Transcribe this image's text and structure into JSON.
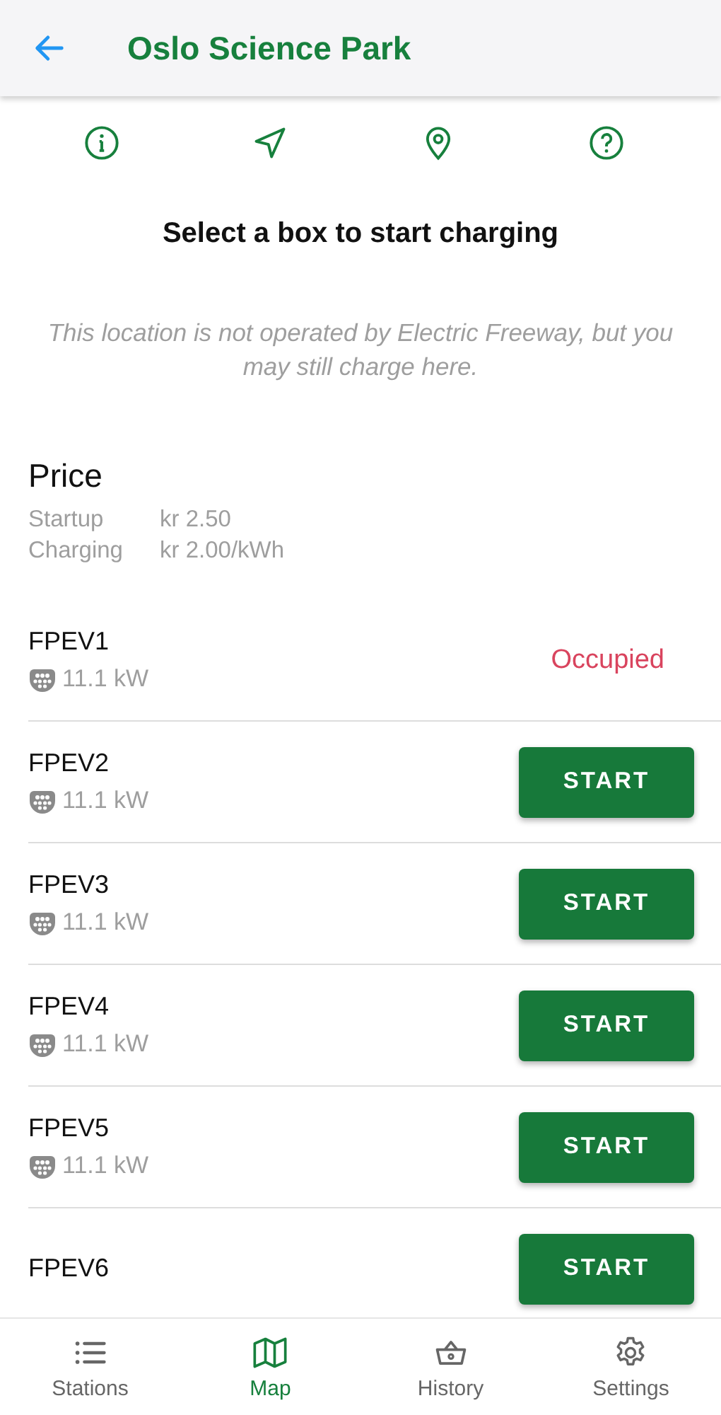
{
  "header": {
    "title": "Oslo Science Park"
  },
  "heading": "Select a box to start charging",
  "notice": "This location is not operated by Electric Freeway, but you may still charge here.",
  "price": {
    "title": "Price",
    "items": [
      {
        "label": "Startup",
        "value": "kr 2.50"
      },
      {
        "label": "Charging",
        "value": "kr 2.00/kWh"
      }
    ]
  },
  "boxes": [
    {
      "name": "FPEV1",
      "power": "11.1 kW",
      "kind": "occupied",
      "status": "Occupied"
    },
    {
      "name": "FPEV2",
      "power": "11.1 kW",
      "kind": "available",
      "button": "START"
    },
    {
      "name": "FPEV3",
      "power": "11.1 kW",
      "kind": "available",
      "button": "START"
    },
    {
      "name": "FPEV4",
      "power": "11.1 kW",
      "kind": "available",
      "button": "START"
    },
    {
      "name": "FPEV5",
      "power": "11.1 kW",
      "kind": "available",
      "button": "START"
    },
    {
      "name": "FPEV6",
      "kind": "available",
      "button": "START"
    }
  ],
  "nav": [
    {
      "label": "Stations",
      "kind": "list",
      "selected": false
    },
    {
      "label": "Map",
      "kind": "map",
      "selected": true
    },
    {
      "label": "History",
      "kind": "basket",
      "selected": false
    },
    {
      "label": "Settings",
      "kind": "gear",
      "selected": false
    }
  ]
}
